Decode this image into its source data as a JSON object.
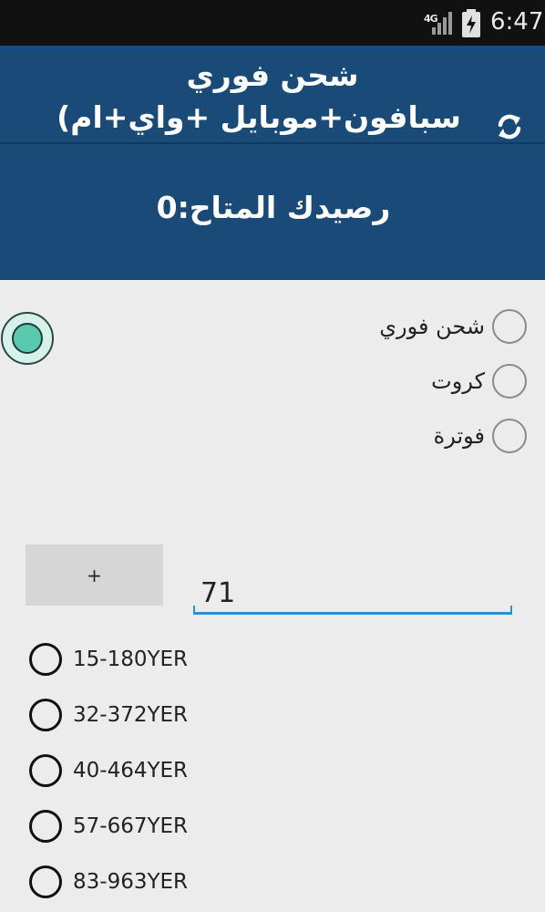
{
  "status_bar": {
    "network": "4G",
    "time": "6:47"
  },
  "header": {
    "title_line1": "شحن فوري",
    "title_line2": "(سبافون+موبايل +واي+ام",
    "refresh_icon": "refresh-icon"
  },
  "balance": {
    "text": "رصيدك المتاح:0"
  },
  "mode_options": [
    {
      "label": "شحن فوري"
    },
    {
      "label": "كروت"
    },
    {
      "label": "فوترة"
    }
  ],
  "plus_button": {
    "label": "+"
  },
  "amount_input": {
    "value": "71"
  },
  "packages": [
    {
      "label": "15-180YER"
    },
    {
      "label": "32-372YER"
    },
    {
      "label": "40-464YER"
    },
    {
      "label": "57-667YER"
    },
    {
      "label": "83-963YER"
    }
  ],
  "colors": {
    "header_bg": "#194a78",
    "accent": "#2c8fd0",
    "float_handle": "#58c9ad"
  }
}
